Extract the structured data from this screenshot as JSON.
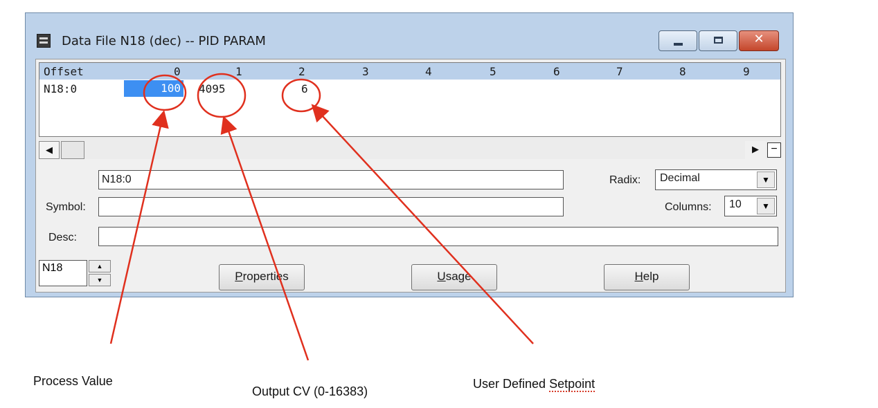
{
  "window": {
    "title": "Data File N18 (dec)  --  PID PARAM",
    "min_glyph": "",
    "close_glyph": "✕"
  },
  "grid": {
    "offset_header": "Offset",
    "column_headers": [
      "0",
      "1",
      "2",
      "3",
      "4",
      "5",
      "6",
      "7",
      "8",
      "9"
    ],
    "row_label": "N18:0",
    "values": [
      "100",
      "4095",
      "6"
    ]
  },
  "scrollbar": {
    "left_arrow": "◀",
    "right_arrow": "▶",
    "collapse": "−"
  },
  "form": {
    "address_value": "N18:0",
    "symbol_label": "Symbol:",
    "symbol_value": "",
    "desc_label": "Desc:",
    "desc_value": "",
    "radix_label": "Radix:",
    "radix_value": "Decimal",
    "columns_label": "Columns:",
    "columns_value": "10",
    "file_spin_value": "N18",
    "spin_up": "▲",
    "spin_down": "▼",
    "combo_arrow": "▼"
  },
  "buttons": {
    "properties": {
      "pre": "",
      "accel": "P",
      "post": "roperties"
    },
    "usage": {
      "pre": "",
      "accel": "U",
      "post": "sage"
    },
    "help": {
      "pre": "",
      "accel": "H",
      "post": "elp"
    }
  },
  "annotations": {
    "process_value": "Process Value",
    "output_cv": "Output CV (0-16383)",
    "setpoint_pre": "User Defined ",
    "setpoint_word": "Setpoint",
    "circle_color": "#e0301e",
    "arrow_color": "#e0301e"
  }
}
